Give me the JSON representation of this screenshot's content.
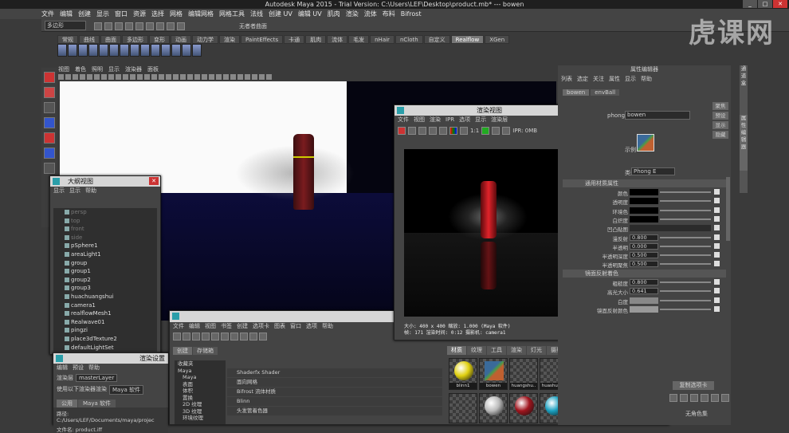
{
  "app": {
    "title": "Autodesk Maya 2015 - Trial Version: C:\\Users\\LEF\\Desktop\\product.mb* --- bowen"
  },
  "menubar": [
    "文件",
    "编辑",
    "创建",
    "显示",
    "窗口",
    "资源",
    "选择",
    "网格",
    "编辑网格",
    "网格工具",
    "法线",
    "创建 UV",
    "编辑 UV",
    "肌肉",
    "渲染",
    "流体",
    "布料",
    "Bifrost"
  ],
  "status": {
    "mode": "多边形",
    "no_selection": "无者者曲面"
  },
  "shelf": {
    "tabs": [
      "常规",
      "曲线",
      "曲面",
      "多边形",
      "变形",
      "动画",
      "动力学",
      "渲染",
      "PaintEffects",
      "卡通",
      "肌肉",
      "流体",
      "毛发",
      "nHair",
      "nCloth",
      "自定义",
      "Realflow",
      "XGen"
    ],
    "active": "Realflow"
  },
  "viewport": {
    "menu": [
      "视图",
      "着色",
      "照明",
      "显示",
      "渲染器",
      "面板"
    ]
  },
  "watermark": "虎课网",
  "outliner": {
    "title": "大纲视图",
    "menu": [
      "显示",
      "显示",
      "帮助"
    ],
    "items": [
      {
        "name": "persp",
        "dim": true
      },
      {
        "name": "top",
        "dim": true
      },
      {
        "name": "front",
        "dim": true
      },
      {
        "name": "side",
        "dim": true
      },
      {
        "name": "pSphere1",
        "dim": false
      },
      {
        "name": "areaLight1",
        "dim": false
      },
      {
        "name": "group",
        "dim": false
      },
      {
        "name": "group1",
        "dim": false
      },
      {
        "name": "group2",
        "dim": false
      },
      {
        "name": "group3",
        "dim": false
      },
      {
        "name": "huachuangshui",
        "dim": false
      },
      {
        "name": "camera1",
        "dim": false
      },
      {
        "name": "realflowMesh1",
        "dim": false
      },
      {
        "name": "Realwave01",
        "dim": false
      },
      {
        "name": "pingzi",
        "dim": false
      },
      {
        "name": "place3dTexture2",
        "dim": false
      },
      {
        "name": "defaultLightSet",
        "dim": false
      }
    ]
  },
  "render_settings": {
    "title": "渲染设置",
    "menu": [
      "编辑",
      "预设",
      "帮助"
    ],
    "layer_label": "渲染层",
    "layer": "masterLayer",
    "renderer_label": "使用以下渲染器渲染",
    "renderer": "Maya 软件",
    "tabs": [
      "公用",
      "Maya 软件"
    ],
    "path_label": "路径:",
    "path": "C:/Users/LEF/Documents/maya/projec",
    "file_label": "文件名:",
    "file": "product.iff"
  },
  "render_view": {
    "title": "渲染视图",
    "menu": [
      "文件",
      "视图",
      "渲染",
      "IPR",
      "选项",
      "显示",
      "渲染层"
    ],
    "ratio": "1:1",
    "ipr": "IPR: 0MB",
    "info1": "大小: 400 x 400  缩放: 1.000          (Maya 软件)",
    "info2": "帧: 171          渲染时间: 0:12         摄影机: camera1"
  },
  "hypershade": {
    "menu": [
      "文件",
      "编辑",
      "视图",
      "书签",
      "创建",
      "选项卡",
      "图表",
      "窗口",
      "选项",
      "帮助"
    ],
    "left_tabs": [
      "创建",
      "存储箱"
    ],
    "tree": [
      "收藏夹",
      "Maya",
      "Maya",
      "表面",
      "体积",
      "置换",
      "2D 纹理",
      "3D 纹理",
      "环境纹理"
    ],
    "create_items": [
      "Shaderfx Shader",
      "面向网格",
      "Bifrost 流体材质",
      "Blinn",
      "头发管着色器"
    ],
    "tabs": [
      "材质",
      "纹理",
      "工具",
      "渲染",
      "灯光",
      "摄影机",
      "着色组",
      "烘焙集",
      "投影"
    ],
    "active_tab": "材质",
    "swatches": [
      {
        "name": "blinn1",
        "color": "#e0d010"
      },
      {
        "name": "bowen",
        "color": "#446688",
        "tex": true
      },
      {
        "name": "huangshu..",
        "color": ""
      },
      {
        "name": "huashuan..",
        "color": ""
      },
      {
        "name": "lambert1",
        "color": "#6a7aa0",
        "tex": true
      },
      {
        "name": "lambert2",
        "color": "#777"
      }
    ],
    "swatches2": [
      {
        "color": ""
      },
      {
        "color": "#bbb"
      },
      {
        "color": "#a0151e"
      },
      {
        "color": "#1aa0c0"
      },
      {
        "color": "#aaa"
      },
      {
        "color": ""
      }
    ]
  },
  "attr_editor": {
    "title": "属性编辑器",
    "menu": [
      "列表",
      "选定",
      "关注",
      "属性",
      "显示",
      "帮助"
    ],
    "tabs": [
      "bowen",
      "envBall"
    ],
    "node_label": "phong:",
    "node_value": "bowen",
    "focus": "聚焦",
    "presets": "预设",
    "show": "显示",
    "hide": "隐藏",
    "sample_label": "示例",
    "type_label": "类型",
    "type": "Phong E",
    "section1": "通用材质属性",
    "rows": [
      {
        "label": "颜色",
        "kind": "swatch",
        "color": "#000"
      },
      {
        "label": "透明度",
        "kind": "swatch",
        "color": "#000"
      },
      {
        "label": "环境色",
        "kind": "swatch",
        "color": "#000"
      },
      {
        "label": "白炽度",
        "kind": "swatch",
        "color": "#000"
      },
      {
        "label": "凹凸贴图",
        "kind": "empty"
      },
      {
        "label": "漫反射",
        "kind": "value",
        "value": "0.800"
      },
      {
        "label": "半透明",
        "kind": "value",
        "value": "0.000"
      },
      {
        "label": "半透明深度",
        "kind": "value",
        "value": "0.500"
      },
      {
        "label": "半透明聚焦",
        "kind": "value",
        "value": "0.500"
      }
    ],
    "section2": "镜面反射着色",
    "rows2": [
      {
        "label": "粗糙度",
        "kind": "value",
        "value": "0.800"
      },
      {
        "label": "高光大小",
        "kind": "value",
        "value": "0.641"
      },
      {
        "label": "白度",
        "kind": "swatch",
        "color": "#888"
      },
      {
        "label": "镜面反射颜色",
        "kind": "swatch",
        "color": "#999"
      }
    ],
    "copy_tab": "复制选项卡",
    "no_char": "无角色集"
  },
  "right_tab": [
    "通道盒",
    "属性编辑器"
  ]
}
